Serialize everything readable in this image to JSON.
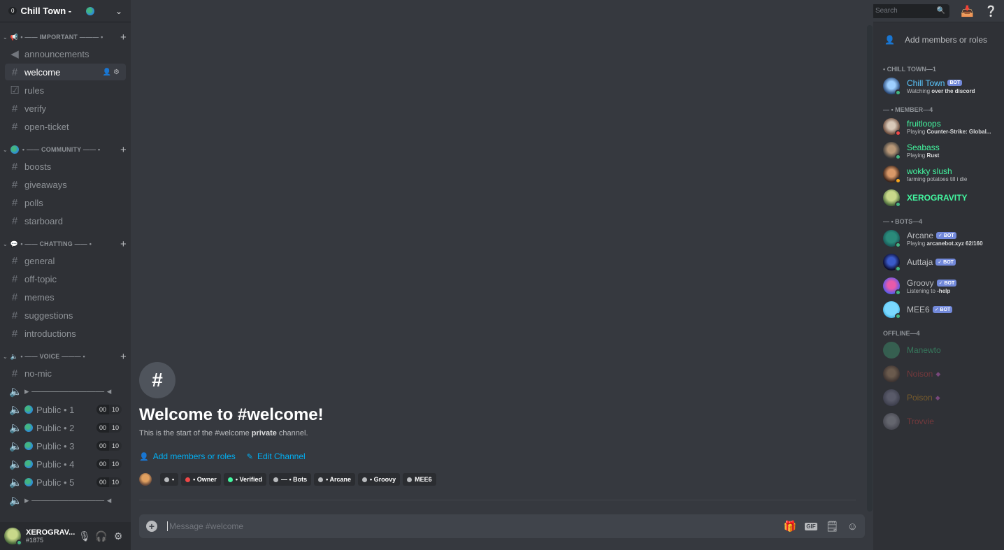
{
  "server": {
    "name": "Chill Town -",
    "badge": "0"
  },
  "header": {
    "channel": "welcome",
    "search_placeholder": "Search"
  },
  "categories": {
    "important": "• —— IMPORTANT ——— •",
    "community": "• —— COMMUNITY —— •",
    "chatting": "• —— CHATTING —— •",
    "voice": "• —— VOICE ——— •"
  },
  "channels": {
    "important": [
      "announcements",
      "welcome",
      "rules",
      "verify",
      "open-ticket"
    ],
    "community": [
      "boosts",
      "giveaways",
      "polls",
      "starboard"
    ],
    "chatting": [
      "general",
      "off-topic",
      "memes",
      "suggestions",
      "introductions"
    ],
    "voice_text": "no-mic",
    "separator": "▸ ———————— ◂",
    "voice": [
      "Public • 1",
      "Public • 2",
      "Public • 3",
      "Public • 4",
      "Public • 5"
    ],
    "voice_count_a": "00",
    "voice_count_b": "10"
  },
  "user": {
    "name": "XEROGRAV...",
    "tag": "#1875"
  },
  "welcome": {
    "title": "Welcome to #welcome!",
    "sub_pre": "This is the start of the #welcome ",
    "sub_bold": "private",
    "sub_post": " channel.",
    "add_members": "Add members or roles",
    "edit_channel": "Edit Channel"
  },
  "roles": [
    {
      "label": "•",
      "color": "#b9bbbe"
    },
    {
      "label": "• Owner",
      "color": "#f04747"
    },
    {
      "label": "• Verified",
      "color": "#43f7a0"
    },
    {
      "label": "— • Bots",
      "color": "#b9bbbe"
    },
    {
      "label": "• Arcane",
      "color": "#b9bbbe"
    },
    {
      "label": "• Groovy",
      "color": "#b9bbbe"
    },
    {
      "label": "MEE6",
      "color": "#b9bbbe"
    }
  ],
  "composer": {
    "placeholder": "Message #welcome",
    "gif": "GIF"
  },
  "members": {
    "add": "Add members or roles",
    "groups": {
      "chilltown": "• CHILL TOWN—1",
      "member": "— • MEMBER—4",
      "bots": "— • BOTS—4",
      "offline": "OFFLINE—4"
    },
    "bot_label": "BOT",
    "bot_verified_label": "✓ BOT",
    "list": {
      "chilltown": {
        "name": "Chill Town",
        "status_pre": "Watching ",
        "status_bold": "over the discord"
      },
      "fruitloops": {
        "name": "fruitloops",
        "status_pre": "Playing ",
        "status_bold": "Counter-Strike: Global..."
      },
      "seabass": {
        "name": "Seabass",
        "status_pre": "Playing ",
        "status_bold": "Rust"
      },
      "wokky": {
        "name": "wokky slush",
        "status_pre": "farming potatoes till i die"
      },
      "xero": {
        "name": "XEROGRAVITY"
      },
      "arcane": {
        "name": "Arcane",
        "status_pre": "Playing ",
        "status_bold": "arcanebot.xyz 62/160"
      },
      "auttaja": {
        "name": "Auttaja"
      },
      "groovy": {
        "name": "Groovy",
        "status_pre": "Listening to ",
        "status_bold": "-help"
      },
      "mee6": {
        "name": "MEE6"
      },
      "manewto": {
        "name": "Manewto"
      },
      "noison": {
        "name": "Noison"
      },
      "poison": {
        "name": "Poison"
      },
      "trovvie": {
        "name": "Trovvie"
      }
    }
  },
  "colors": {
    "accent_link": "#00b0f4",
    "member_green": "#43f7a0",
    "bot_blurple": "#7289da",
    "online": "#43b581"
  }
}
